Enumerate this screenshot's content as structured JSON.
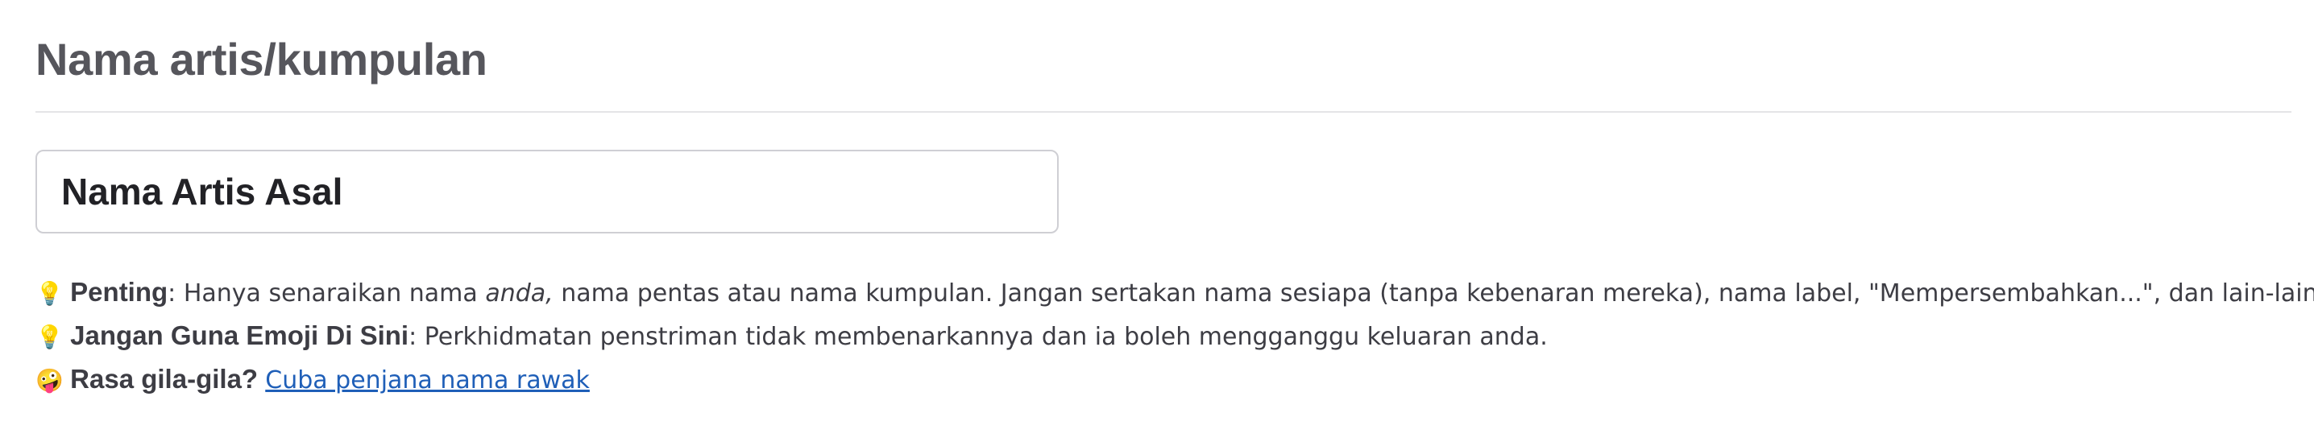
{
  "section": {
    "title": "Nama artis/kumpulan"
  },
  "artist_name_input": {
    "value": "Nama Artis Asal",
    "placeholder": "Nama Artis Asal"
  },
  "hints": {
    "important": {
      "icon": "lightbulb-icon",
      "icon_glyph": "💡",
      "label": "Penting",
      "text_before": ": Hanya senaraikan nama ",
      "text_emphasis": "anda,",
      "text_after": " nama pentas atau nama kumpulan. Jangan sertakan nama sesiapa (tanpa kebenaran mereka), nama label, \"Mempersembahkan...\", dan lain-lain."
    },
    "no_emoji": {
      "icon": "lightbulb-icon",
      "icon_glyph": "💡",
      "label": "Jangan Guna Emoji Di Sini",
      "text": ": Perkhidmatan penstriman tidak membenarkannya dan ia boleh mengganggu keluaran anda."
    },
    "random": {
      "icon": "zany-face-icon",
      "icon_glyph": "🤪",
      "label": "Rasa gila-gila?",
      "link": "Cuba penjana nama rawak"
    }
  },
  "colors": {
    "title": "#56565c",
    "text": "#3d3d44",
    "link": "#1f5fb8",
    "input_border": "#cfcfd4",
    "divider": "#e4e4e7"
  }
}
